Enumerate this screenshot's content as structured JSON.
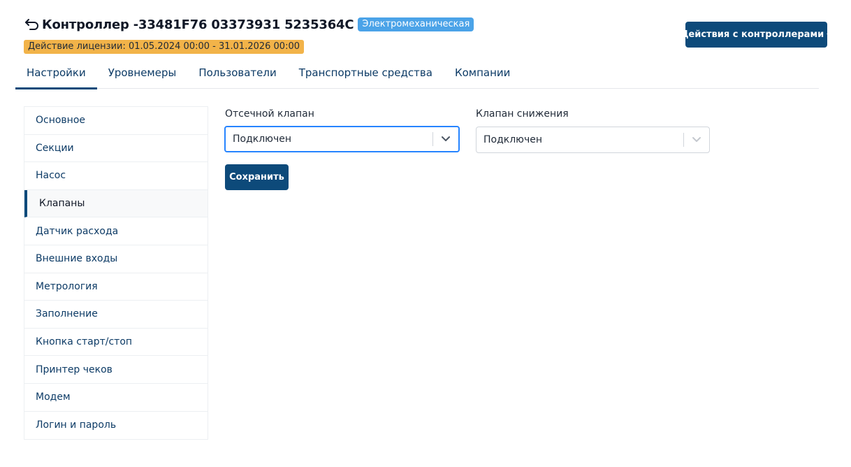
{
  "header": {
    "title": "Контроллер -33481F76 03373931 5235364C",
    "type_badge": "Электромеханическая",
    "license": "Действие лицензии: 01.05.2024 00:00 - 31.01.2026 00:00",
    "actions_label": "Действия с контроллерами"
  },
  "tabs": [
    {
      "label": "Настройки"
    },
    {
      "label": "Уровнемеры"
    },
    {
      "label": "Пользователи"
    },
    {
      "label": "Транспортные средства"
    },
    {
      "label": "Компании"
    }
  ],
  "sidebar": {
    "items": [
      {
        "label": "Основное"
      },
      {
        "label": "Секции"
      },
      {
        "label": "Насос"
      },
      {
        "label": "Клапаны"
      },
      {
        "label": "Датчик расхода"
      },
      {
        "label": "Внешние входы"
      },
      {
        "label": "Метрология"
      },
      {
        "label": "Заполнение"
      },
      {
        "label": "Кнопка старт/стоп"
      },
      {
        "label": "Принтер чеков"
      },
      {
        "label": "Модем"
      },
      {
        "label": "Логин и пароль"
      }
    ]
  },
  "form": {
    "cutoff_valve": {
      "label": "Отсечной клапан",
      "value": "Подключен"
    },
    "reduction_valve": {
      "label": "Клапан снижения",
      "value": "Подключен"
    },
    "save_label": "Сохранить"
  },
  "colors": {
    "primary": "#0d4a7a",
    "badge_info": "#4ba3e8",
    "badge_warning": "#f2b349",
    "focus": "#2684ff"
  },
  "icons": {
    "back": "back-arrow-icon",
    "dropdown": "chevron-down-icon"
  }
}
